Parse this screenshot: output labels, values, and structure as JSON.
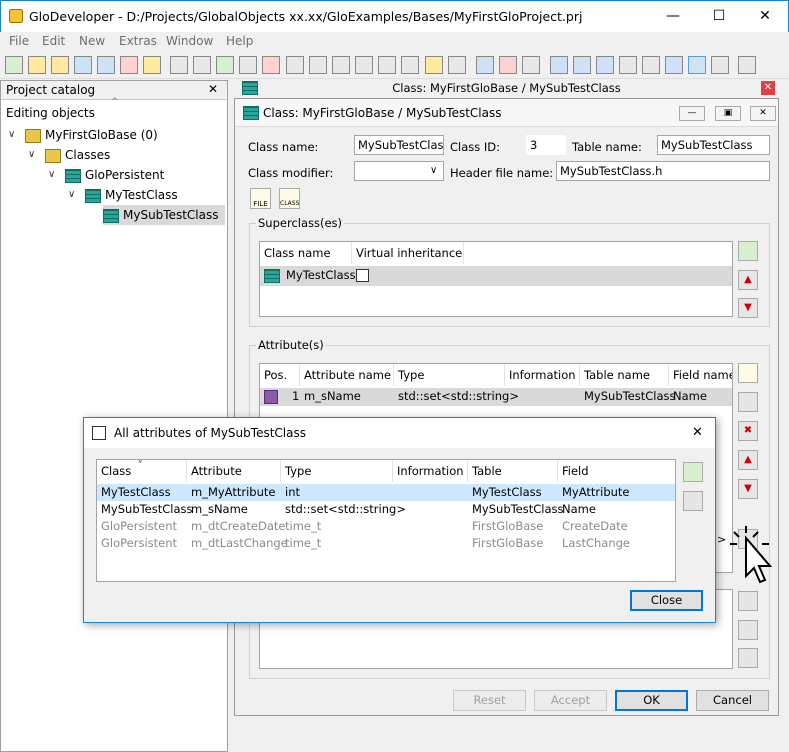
{
  "window": {
    "title": "GloDeveloper - D:/Projects/GlobalObjects xx.xx/GloExamples/Bases/MyFirstGloProject.prj",
    "minimize": "—",
    "maximize": "☐",
    "close": "✕"
  },
  "menu": [
    "File",
    "Edit",
    "New",
    "Extras",
    "Window",
    "Help"
  ],
  "left_panel": {
    "title": "Project catalog",
    "close": "✕",
    "subtitle": "Editing objects",
    "tree": [
      {
        "label": "MyFirstGloBase (0)",
        "icon": "database-icon"
      },
      {
        "label": "Classes",
        "icon": "folder-icon"
      },
      {
        "label": "GloPersistent",
        "icon": "class-icon"
      },
      {
        "label": "MyTestClass",
        "icon": "class-icon"
      },
      {
        "label": "MySubTestClass",
        "icon": "class-icon"
      }
    ]
  },
  "mdi": {
    "title": "Class: MyFirstGloBase / MySubTestClass",
    "close": "✕"
  },
  "class_dialog": {
    "title": "Class: MyFirstGloBase / MySubTestClass",
    "class_name_label": "Class name:",
    "class_name": "MySubTestClass",
    "class_id_label": "Class ID:",
    "class_id": "3",
    "table_name_label": "Table name:",
    "table_name": "MySubTestClass",
    "class_modifier_label": "Class modifier:",
    "class_modifier": "",
    "header_file_label": "Header file name:",
    "header_file": "MySubTestClass.h",
    "file_btn": "FILE",
    "class_btn": "CLASS",
    "superclass_group": "Superclass(es)",
    "superclass_headers": [
      "Class name",
      "Virtual inheritance"
    ],
    "superclass_rows": [
      {
        "name": "MyTestClass",
        "virtual": false
      }
    ],
    "attributes_group": "Attribute(s)",
    "attr_headers": [
      "Pos.",
      "Attribute name",
      "Type",
      "Information",
      "Table name",
      "Field name"
    ],
    "attr_rows": [
      {
        "pos": "1",
        "name": "m_sName",
        "type": "std::set<std::string>",
        "info": "",
        "table": "MySubTestClass",
        "field": "Name"
      }
    ],
    "buttons": {
      "reset": "Reset",
      "accept": "Accept",
      "ok": "OK",
      "cancel": "Cancel"
    }
  },
  "popup": {
    "title": "All attributes of MySubTestClass",
    "close": "✕",
    "headers": [
      "Class",
      "Attribute",
      "Type",
      "Information",
      "Table",
      "Field"
    ],
    "rows": [
      {
        "class": "MyTestClass",
        "attribute": "m_MyAttribute",
        "type": "int",
        "info": "",
        "table": "MyTestClass",
        "field": "MyAttribute",
        "selected": true,
        "inherited": false
      },
      {
        "class": "MySubTestClass",
        "attribute": "m_sName",
        "type": "std::set<std::string>",
        "info": "",
        "table": "MySubTestClass",
        "field": "Name",
        "selected": false,
        "inherited": false
      },
      {
        "class": "GloPersistent",
        "attribute": "m_dtCreateDate",
        "type": "time_t",
        "info": "",
        "table": "FirstGloBase",
        "field": "CreateDate",
        "selected": false,
        "inherited": true
      },
      {
        "class": "GloPersistent",
        "attribute": "m_dtLastChange",
        "type": "time_t",
        "info": "",
        "table": "FirstGloBase",
        "field": "LastChange",
        "selected": false,
        "inherited": true
      }
    ],
    "close_button": "Close"
  },
  "colors": {
    "selection": "#cce8ff",
    "accent": "#0078d7",
    "inherited_text": "#8a8a8a"
  }
}
